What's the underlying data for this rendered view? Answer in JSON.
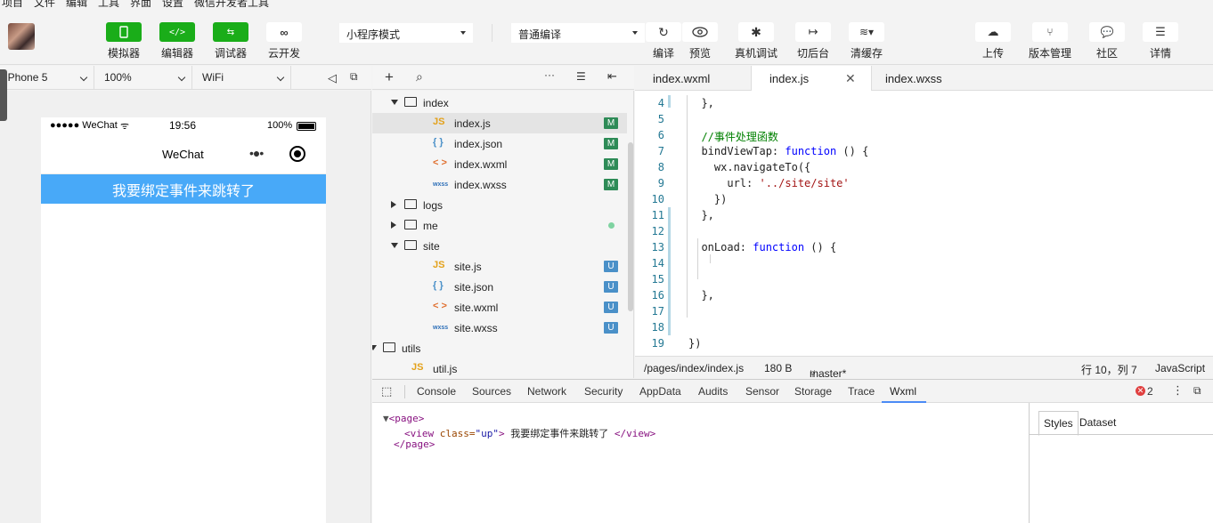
{
  "menubar": [
    "项目",
    "文件",
    "编辑",
    "工具",
    "界面",
    "设置",
    "微信开发者工具"
  ],
  "toolbar": {
    "left_buttons": [
      {
        "label": "模拟器",
        "icon": "phone-icon"
      },
      {
        "label": "编辑器",
        "icon": "code-icon"
      },
      {
        "label": "调试器",
        "icon": "debug-toggle-icon"
      },
      {
        "label": "云开发",
        "icon": "cloud-link-icon"
      }
    ],
    "mode_select": "小程序模式",
    "compile_select": "普通编译",
    "mid_buttons": [
      {
        "label": "编译",
        "icon": "refresh-icon"
      },
      {
        "label": "预览",
        "icon": "eye-icon"
      },
      {
        "label": "真机调试",
        "icon": "bug-icon"
      },
      {
        "label": "切后台",
        "icon": "switch-background-icon"
      },
      {
        "label": "清缓存",
        "icon": "layers-icon"
      }
    ],
    "right_buttons": [
      {
        "label": "上传",
        "icon": "upload-cloud-icon"
      },
      {
        "label": "版本管理",
        "icon": "branch-icon"
      },
      {
        "label": "社区",
        "icon": "chat-icon"
      },
      {
        "label": "详情",
        "icon": "menu-icon"
      }
    ]
  },
  "simulator": {
    "device": "iPhone 5",
    "zoom": "100%",
    "network": "WiFi",
    "status": {
      "carrier": "●●●●● WeChat",
      "time": "19:56",
      "battery": "100%"
    },
    "nav_title": "WeChat",
    "jump_text": "我要绑定事件来跳转了"
  },
  "tree": {
    "rows": [
      {
        "name": "index",
        "type": "folder",
        "open": true,
        "depth": 0,
        "badge": ""
      },
      {
        "name": "index.js",
        "type": "js",
        "depth": 1,
        "badge": "M",
        "selected": true
      },
      {
        "name": "index.json",
        "type": "json",
        "depth": 1,
        "badge": "M"
      },
      {
        "name": "index.wxml",
        "type": "wxml",
        "depth": 1,
        "badge": "M"
      },
      {
        "name": "index.wxss",
        "type": "wxss",
        "depth": 1,
        "badge": "M"
      },
      {
        "name": "logs",
        "type": "folder",
        "open": false,
        "depth": 0,
        "badge": ""
      },
      {
        "name": "me",
        "type": "folder",
        "open": false,
        "depth": 0,
        "badge": "dot"
      },
      {
        "name": "site",
        "type": "folder",
        "open": true,
        "depth": 0,
        "badge": ""
      },
      {
        "name": "site.js",
        "type": "js",
        "depth": 1,
        "badge": "U"
      },
      {
        "name": "site.json",
        "type": "json",
        "depth": 1,
        "badge": "U"
      },
      {
        "name": "site.wxml",
        "type": "wxml",
        "depth": 1,
        "badge": "U"
      },
      {
        "name": "site.wxss",
        "type": "wxss",
        "depth": 1,
        "badge": "U"
      },
      {
        "name": "utils",
        "type": "folder",
        "open": true,
        "depth": -1,
        "badge": ""
      },
      {
        "name": "util.js",
        "type": "js",
        "depth": 0,
        "badge": ""
      }
    ]
  },
  "editor": {
    "tabs": [
      "index.wxml",
      "index.js",
      "index.wxss"
    ],
    "active_tab": "index.js",
    "lines": [
      {
        "n": "4",
        "code": "  },"
      },
      {
        "n": "5",
        "code": ""
      },
      {
        "n": "6",
        "code": "  //事件处理函数"
      },
      {
        "n": "7",
        "code": "  bindViewTap: function () {"
      },
      {
        "n": "8",
        "code": "    wx.navigateTo({"
      },
      {
        "n": "9",
        "code": "      url: '../site/site'"
      },
      {
        "n": "10",
        "code": "    })"
      },
      {
        "n": "11",
        "code": "  },"
      },
      {
        "n": "12",
        "code": ""
      },
      {
        "n": "13",
        "code": "  onLoad: function () {"
      },
      {
        "n": "14",
        "code": ""
      },
      {
        "n": "15",
        "code": ""
      },
      {
        "n": "16",
        "code": "  },"
      },
      {
        "n": "17",
        "code": ""
      },
      {
        "n": "18",
        "code": ""
      },
      {
        "n": "19",
        "code": "})"
      }
    ],
    "status": {
      "path": "/pages/index/index.js",
      "size": "180 B",
      "branch": "master*",
      "position": "行 10，列 7",
      "language": "JavaScript"
    }
  },
  "devtools": {
    "tabs": [
      "Console",
      "Sources",
      "Network",
      "Security",
      "AppData",
      "Audits",
      "Sensor",
      "Storage",
      "Trace",
      "Wxml"
    ],
    "active_tab": "Wxml",
    "error_count": "2",
    "dom": {
      "page_open": "<page>",
      "view_text": "我要绑定事件来跳转了",
      "view_class": "up",
      "page_close": "</page>"
    },
    "side_tabs": [
      "Styles",
      "Dataset"
    ]
  }
}
